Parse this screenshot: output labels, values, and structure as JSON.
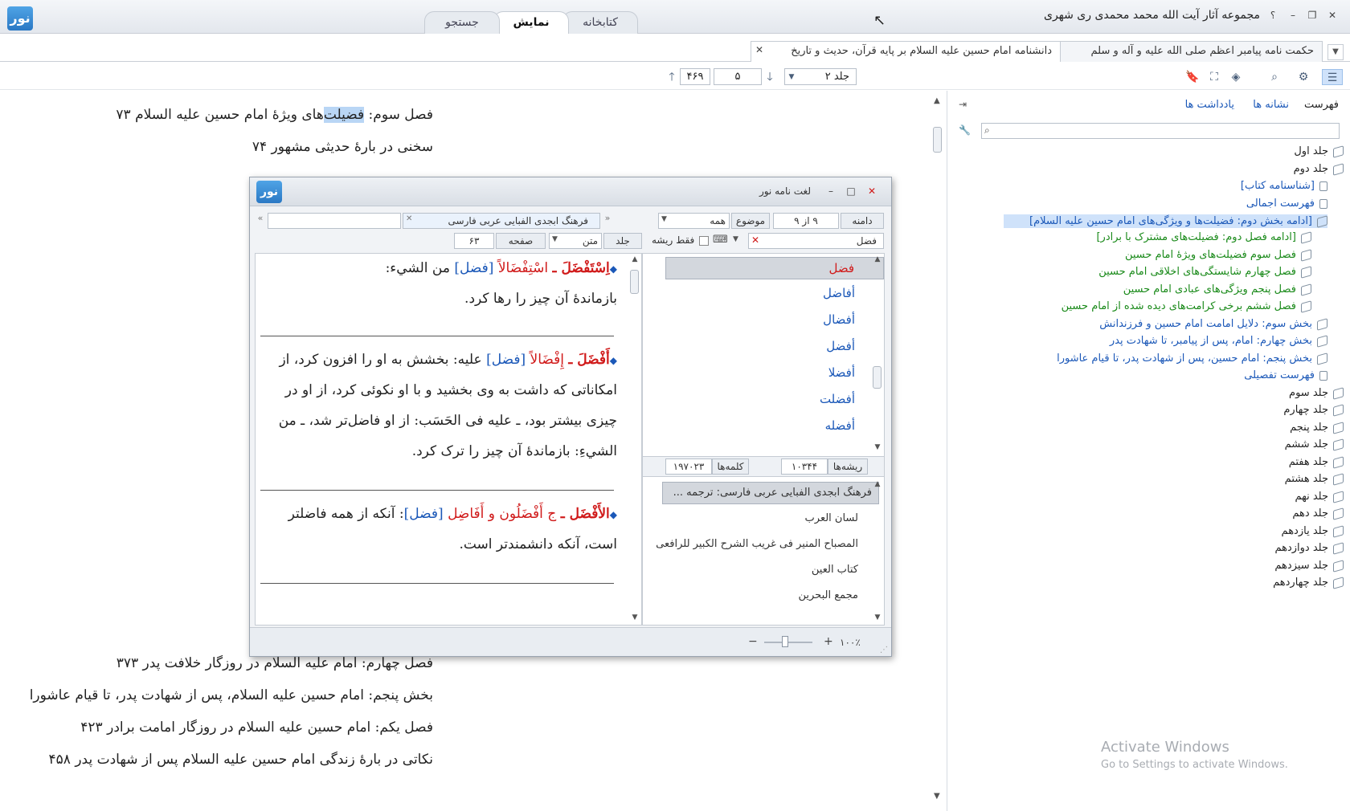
{
  "app": {
    "title": "مجموعه آثار آیت الله محمد محمدی ری شهری",
    "logo_text": "نور",
    "help": "؟"
  },
  "main_tabs": [
    {
      "label": "کتابخانه"
    },
    {
      "label": "نمایش"
    },
    {
      "label": "جستجو"
    }
  ],
  "doc_tabs": [
    {
      "label": "حکمت نامه پیامبر اعظم صلی الله علیه و آله و سلم"
    },
    {
      "label": "دانشنامه امام حسین علیه السلام بر پایه قرآن، حدیث و تاریخ"
    }
  ],
  "nav": {
    "volume": "جلد ۲",
    "page": "۵",
    "total": "۴۶۹"
  },
  "content": {
    "lines_top": [
      "فصل سوم: فضیلت‌های ویژهٔ امام حسین علیه السلام ۷۳",
      "سخنی در بارهٔ حدیثی مشهور ۷۴"
    ],
    "highlight": "فضیلت",
    "lines_bottom": [
      "فصل چهارم: امام علیه السلام در روزگار خلافت پدر ۳۷۳",
      "بخش پنجم: امام حسین علیه السلام، پس از شهادت پدر، تا قیام عاشورا",
      "فصل یکم: امام حسین علیه السلام در روزگار امامت برادر ۴۲۳",
      "نکاتی در بارهٔ زندگی امام حسین علیه السلام پس از شهادت پدر ۴۵۸"
    ]
  },
  "sidebar": {
    "tabs": [
      {
        "label": "فهرست"
      },
      {
        "label": "نشانه ها"
      },
      {
        "label": "یادداشت ها"
      }
    ],
    "tree": [
      {
        "label": "جلد اول"
      },
      {
        "label": "جلد دوم"
      },
      {
        "label": "[شناسنامه کتاب]"
      },
      {
        "label": "فهرست اجمالی"
      },
      {
        "label": "[ادامه بخش دوم: فضیلت‌ها و ویژگی‌های امام حسین علیه السلام]"
      },
      {
        "label": "[ادامه فصل دوم: فضیلت‌های مشترک با برادر]"
      },
      {
        "label": "فصل سوم فضیلت‌های ویژهٔ امام حسین"
      },
      {
        "label": "فصل چهارم شایستگی‌های اخلاقی امام حسین"
      },
      {
        "label": "فصل پنجم ویژگی‌های عبادی امام حسین"
      },
      {
        "label": "فصل ششم برخی کرامت‌های دیده شده از امام حسین"
      },
      {
        "label": "بخش سوم: دلایل امامت امام حسین و فرزندانش"
      },
      {
        "label": "بخش چهارم: امام، پس از پیامبر، تا شهادت پدر"
      },
      {
        "label": "بخش پنجم: امام حسین، پس از شهادت پدر، تا قیام عاشورا"
      },
      {
        "label": "فهرست تفصیلی"
      },
      {
        "label": "جلد سوم"
      },
      {
        "label": "جلد چهارم"
      },
      {
        "label": "جلد پنجم"
      },
      {
        "label": "جلد ششم"
      },
      {
        "label": "جلد هفتم"
      },
      {
        "label": "جلد هشتم"
      },
      {
        "label": "جلد نهم"
      },
      {
        "label": "جلد دهم"
      },
      {
        "label": "جلد یازدهم"
      },
      {
        "label": "جلد دوازدهم"
      },
      {
        "label": "جلد سیزدهم"
      },
      {
        "label": "جلد چهاردهم"
      }
    ]
  },
  "watermark": {
    "line1": "Activate Windows",
    "line2": "Go to Settings to activate Windows."
  },
  "lexicon": {
    "title": "لغت نامه نور",
    "logo_text": "نور",
    "domain_label": "دامنه",
    "domain_value": "۹ از ۹",
    "topic_label": "موضوع",
    "topic_value": "همه",
    "book_name": "فرهنگ ابجدی الفبایی عربی  فارسی",
    "vol_label": "جلد",
    "text_label": "متن",
    "page_label": "صفحه",
    "page_value": "۶۳",
    "search_value": "فضل",
    "root_only": "فقط ریشه",
    "entries": [
      {
        "head": "اِسْتَفْضَلَ ـ",
        "form": "اسْتِفْضَالاً",
        "root": "[فضل]",
        "rest": "من الشيء:",
        "line2": "بازماندهٔ آن چیز را رها کرد."
      },
      {
        "head": "أَفْضَلَ ـ",
        "form": "إِفْضَالاً",
        "root": "[فضل]",
        "rest": "علیه: بخشش به او را افزون کرد، از",
        "line2": "امکاناتی که داشت به وی بخشید و با او نکوئی کرد، از او در",
        "line3": "چیزی بیشتر بود، ـ علیه فی الحَسَب: از او فاضل‌تر شد، ـ من",
        "line4": "الشيءِ: بازماندهٔ آن چیز را ترک کرد."
      },
      {
        "head": "الأَفْضَل ـ",
        "form": "ج أَفْضَلُون و أَفَاضِل",
        "root": "[فضل]",
        "rest": ": آنکه از همه فاضلتر",
        "line2": "است، آنکه دانشمندتر است."
      }
    ],
    "words": [
      {
        "label": "فضل"
      },
      {
        "label": "أفاضل"
      },
      {
        "label": "أفضال"
      },
      {
        "label": "أفضل"
      },
      {
        "label": "أفضلا"
      },
      {
        "label": "أفضلت"
      },
      {
        "label": "أفضله"
      }
    ],
    "roots_label": "ریشه‌ها",
    "roots_count": "۱۰۳۴۴",
    "words_label": "کلمه‌ها",
    "words_count": "۱۹۷۰۲۳",
    "dictionaries": [
      {
        "label": "فرهنگ ابجدی الفبایی عربی  فارسی: ترجمه ..."
      },
      {
        "label": "لسان العرب"
      },
      {
        "label": "المصباح المنير فی غريب الشرح الكبير للرافعی"
      },
      {
        "label": "كتاب العين"
      },
      {
        "label": "مجمع البحرين"
      }
    ],
    "zoom": "۱۰۰٪"
  }
}
